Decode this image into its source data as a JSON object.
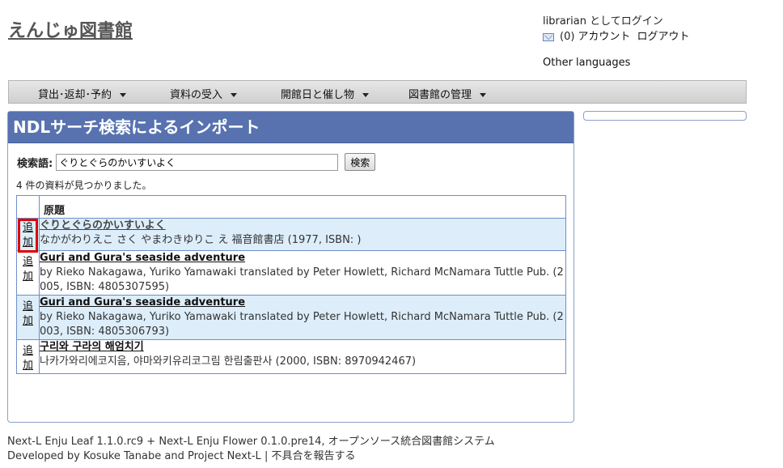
{
  "site": {
    "title": "えんじゅ図書館"
  },
  "user": {
    "login_text": "librarian としてログイン",
    "message_count": "(0)",
    "account_label": "アカウント",
    "logout_label": "ログアウト",
    "other_languages": "Other languages"
  },
  "nav": {
    "items": [
      {
        "label": "貸出･返却･予約"
      },
      {
        "label": "資料の受入"
      },
      {
        "label": "開館日と催し物"
      },
      {
        "label": "図書館の管理"
      }
    ]
  },
  "page": {
    "title": "NDLサーチ検索によるインポート",
    "search_label": "検索語:",
    "search_value": "ぐりとぐらのかいすいよく",
    "search_button": "検索",
    "result_count": "4 件の資料が見つかりました。"
  },
  "table": {
    "header": "原題",
    "add_label_1": "追",
    "add_label_2": "加",
    "rows": [
      {
        "title": "ぐりとぐらのかいすいよく",
        "description": "なかがわりえこ さく やまわきゆりこ え 福音館書店 (1977, ISBN: )"
      },
      {
        "title": "Guri and Gura's seaside adventure",
        "description": "by Rieko Nakagawa, Yuriko Yamawaki translated by Peter Howlett, Richard McNamara Tuttle Pub. (2005, ISBN: 4805307595)"
      },
      {
        "title": "Guri and Gura's seaside adventure",
        "description": "by Rieko Nakagawa, Yuriko Yamawaki translated by Peter Howlett, Richard McNamara Tuttle Pub. (2003, ISBN: 4805306793)"
      },
      {
        "title": "구리와 구라의 해엄치기",
        "description": "나카가와리에코지음, 야마와키유리코그림 한림출판사 (2000, ISBN: 8970942467)"
      }
    ]
  },
  "footer": {
    "leaf_link": "Next-L Enju Leaf 1.1.0.rc9",
    "plus": " + ",
    "flower_link": "Next-L Enju Flower 0.1.0.pre14",
    "tagline": ", オープンソース統合図書館システム",
    "developed_by": "Developed by ",
    "author_link": "Kosuke Tanabe",
    "and": " and ",
    "project_link": "Project Next-L",
    "separator": " | ",
    "report_link": "不具合を報告する"
  },
  "colors": {
    "header_blue": "#5872b0",
    "row_highlight": "#ddeefa",
    "callout_red": "#e00000"
  }
}
